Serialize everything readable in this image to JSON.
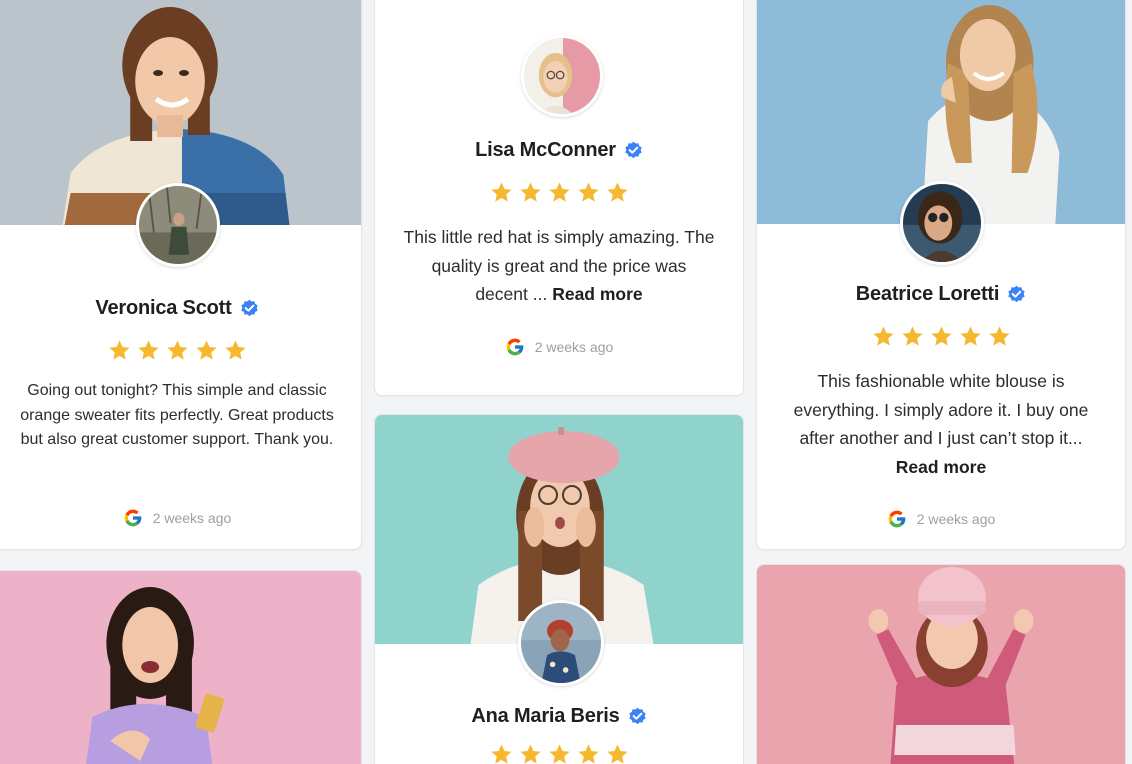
{
  "colors": {
    "star": "#f5b82e",
    "verified": "#3b82f6",
    "card_bg": "#ffffff",
    "page_bg": "#f3f4f6"
  },
  "icons": {
    "star": "star-icon",
    "verified": "verified-badge-icon",
    "source": "google-icon"
  },
  "reviews": [
    {
      "name": "Veronica Scott",
      "rating": 5,
      "text": "Going out tonight? This simple and classic orange sweater fits perfectly. Great products but also great customer support. Thank you.",
      "read_more": "",
      "time": "2 weeks ago"
    },
    {
      "name": "Lisa McConner",
      "rating": 5,
      "text": "This little red hat is simply amazing. The quality is great and the price was decent ...",
      "read_more": "Read more",
      "time": "2 weeks ago"
    },
    {
      "name": "Beatrice Loretti",
      "rating": 5,
      "text": "This fashionable white blouse is everything. I simply adore it. I buy one after another and I just can’t stop it...",
      "read_more": "Read more",
      "time": "2 weeks ago"
    },
    {
      "name": "Ana Maria Beris",
      "rating": 5
    }
  ]
}
